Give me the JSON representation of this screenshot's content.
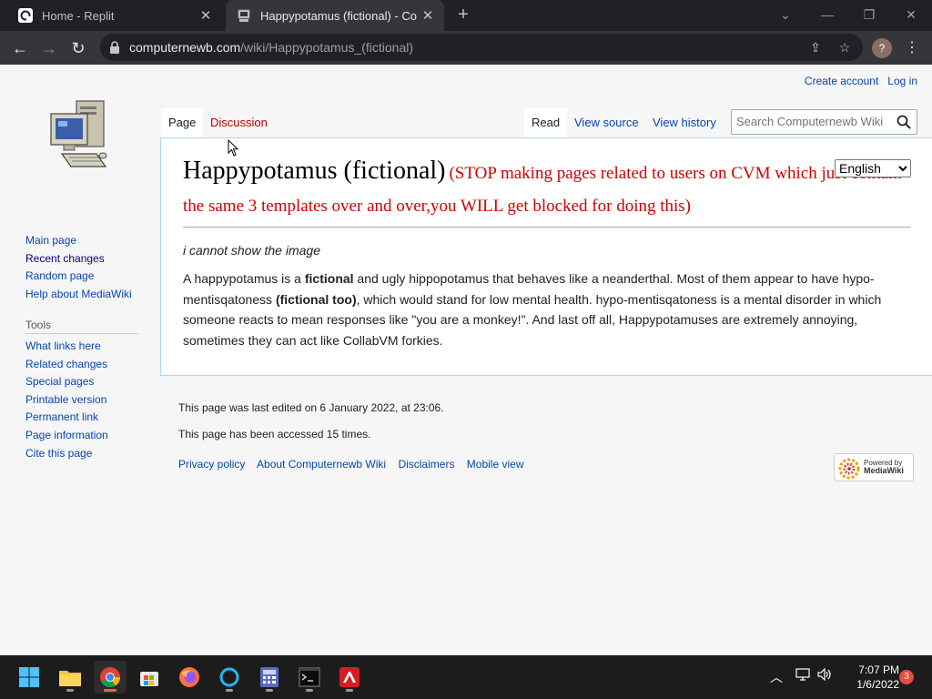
{
  "browser": {
    "tabs": [
      {
        "title": "Home - Replit",
        "favicon": "replit-icon",
        "active": false
      },
      {
        "title": "Happypotamus (fictional) - Comp",
        "favicon": "computer-icon",
        "active": true
      }
    ],
    "close_glyph": "✕",
    "new_tab_glyph": "+",
    "url_host": "computernewb.com",
    "url_path": "/wiki/Happypotamus_(fictional)",
    "profile_initial": "?"
  },
  "wiki": {
    "personal": {
      "create_account": "Create account",
      "log_in": "Log in"
    },
    "tabs": {
      "page": "Page",
      "discussion": "Discussion",
      "read": "Read",
      "view_source": "View source",
      "view_history": "View history"
    },
    "search_placeholder": "Search Computernewb Wiki",
    "sidebar": {
      "nav": [
        "Main page",
        "Recent changes",
        "Random page",
        "Help about MediaWiki"
      ],
      "tools_heading": "Tools",
      "tools": [
        "What links here",
        "Related changes",
        "Special pages",
        "Printable version",
        "Permanent link",
        "Page information",
        "Cite this page"
      ]
    },
    "title": "Happypotamus (fictional)",
    "warning": "(STOP making pages related to users on CVM which just contain the same 3 templates over and over,you WILL get blocked for doing this)",
    "language": "English",
    "italic_note": "i cannot show the image",
    "body": {
      "p1": "A happypotamus is a ",
      "b1": "fictional",
      "p2": " and ugly hippopotamus that behaves like a neanderthal. Most of them appear to have hypo-mentisqatoness ",
      "b2": "(fictional too)",
      "p3": ", which would stand for low mental health. hypo-mentisqatoness is a mental disorder in which someone reacts to mean responses like \"you are a monkey!\". And last off all, Happypotamuses are extremely annoying, sometimes they can act like CollabVM forkies."
    },
    "footer": {
      "last_edited": "This page was last edited on 6 January 2022, at 23:06.",
      "accessed": "This page has been accessed 15 times.",
      "links": [
        "Privacy policy",
        "About Computernewb Wiki",
        "Disclaimers",
        "Mobile view"
      ],
      "powered_line1": "Powered by",
      "powered_line2": "MediaWiki"
    }
  },
  "taskbar": {
    "apps": [
      "start-icon",
      "file-explorer-icon",
      "chrome-icon",
      "store-icon",
      "firefox-icon",
      "cortana-icon",
      "calculator-icon",
      "terminal-icon",
      "avira-icon"
    ],
    "time": "7:07 PM",
    "date": "1/6/2022",
    "notifications": "3"
  },
  "colors": {
    "link": "#0645ad",
    "redlink": "#ba0000",
    "warning": "#d00000",
    "taskbar": "#1c1c1c"
  }
}
